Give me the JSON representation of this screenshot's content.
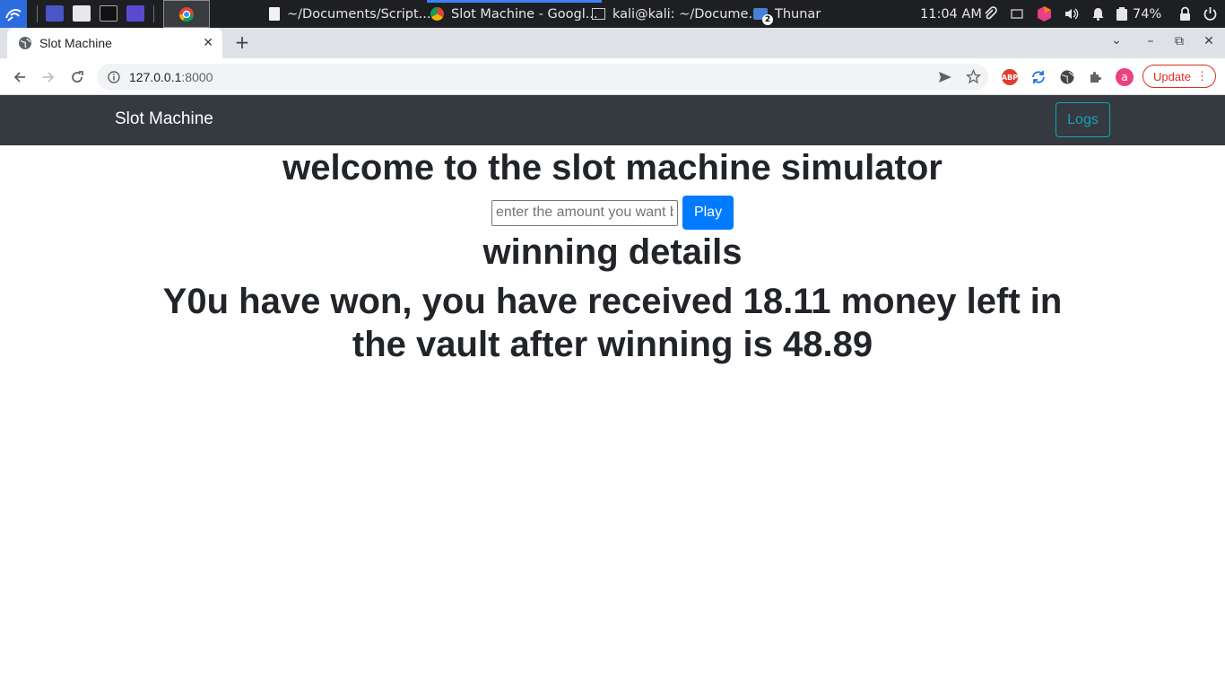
{
  "taskbar": {
    "windows": [
      {
        "label": "~/Documents/Script..."
      },
      {
        "label": "Slot Machine - Googl..."
      },
      {
        "label": "kali@kali: ~/Docume..."
      },
      {
        "label": "Thunar"
      }
    ],
    "thunar_badge": "2",
    "clock": "11:04 AM",
    "battery": "74%"
  },
  "browser": {
    "tab_title": "Slot Machine",
    "url_host": "127.0.0.1",
    "url_port": ":8000",
    "update_label": "Update",
    "avatar_letter": "a",
    "abp_label": "ABP"
  },
  "page": {
    "brand": "Slot Machine",
    "logs_label": "Logs",
    "welcome": "welcome to the slot machine simulator",
    "amount_placeholder": "enter the amount you want bet",
    "play_label": "Play",
    "winning_title": "winning details",
    "result_text": "Y0u have won, you have received 18.11 money left in the vault after winning is 48.89"
  },
  "colors": {
    "navbar_bg": "#343a40",
    "primary": "#007bff",
    "info": "#17a2b8",
    "update_red": "#d93025"
  }
}
